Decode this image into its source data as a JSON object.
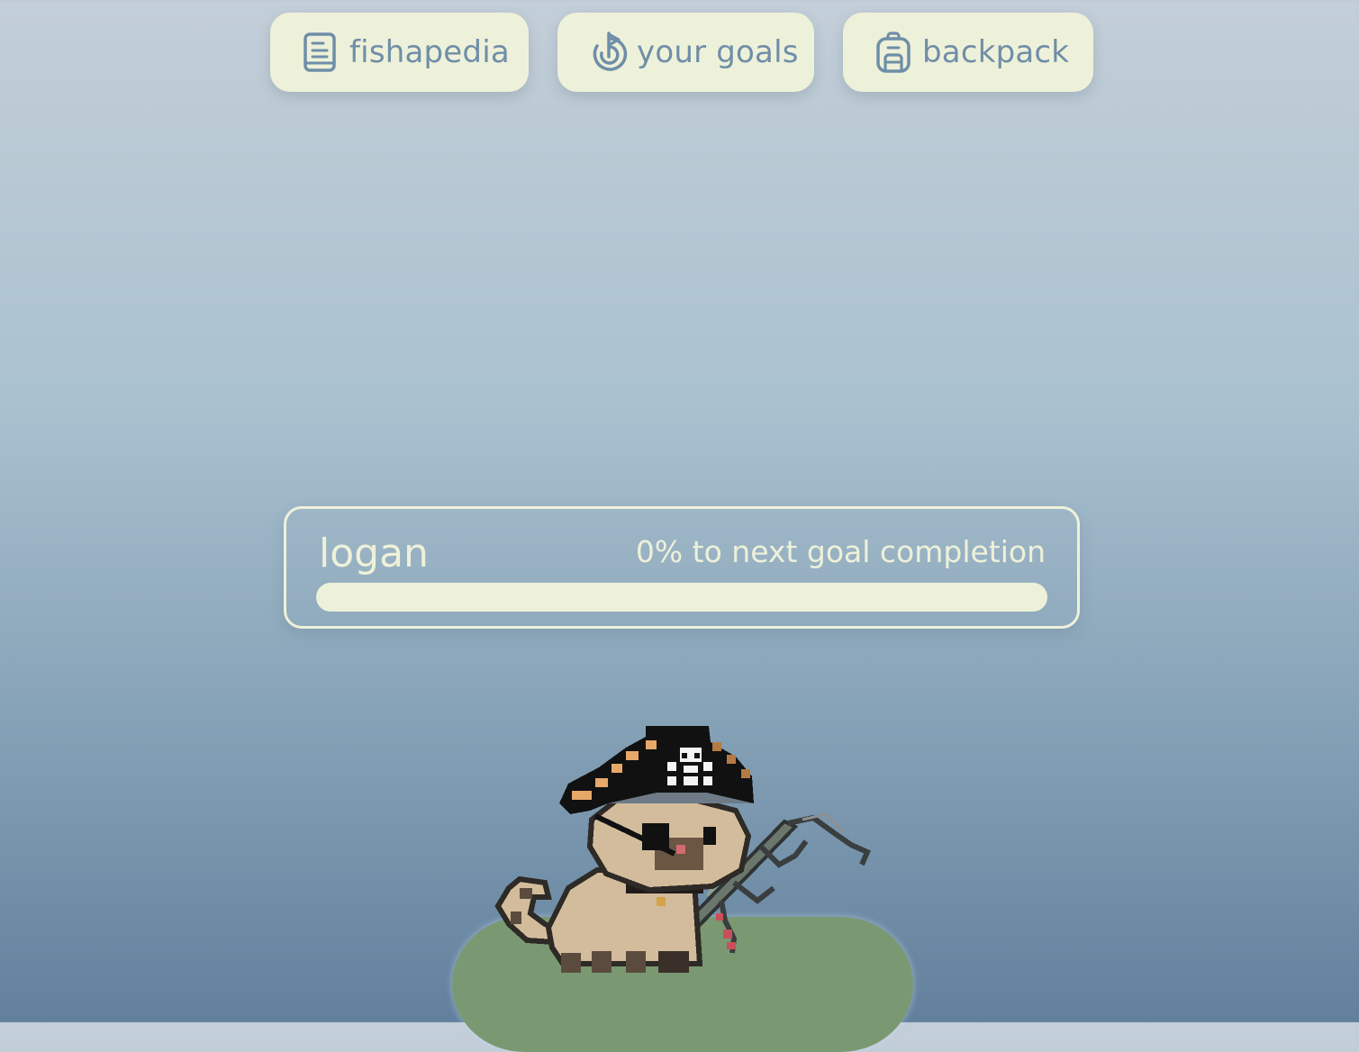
{
  "nav": {
    "fishapedia": {
      "label": "fishapedia",
      "icon": "book-icon"
    },
    "goals": {
      "label": "your goals",
      "icon": "target-icon"
    },
    "backpack": {
      "label": "backpack",
      "icon": "backpack-icon"
    }
  },
  "player": {
    "name": "logan",
    "progress_text": "0% to next goal completion",
    "progress_fraction": 0
  },
  "scene": {
    "character": "pirate-cat-with-fishing-rod",
    "island_color": "#7a9972"
  },
  "colors": {
    "button_bg": "#eef1d9",
    "button_text": "#6f8ea8",
    "panel_border": "#eef1d9"
  }
}
